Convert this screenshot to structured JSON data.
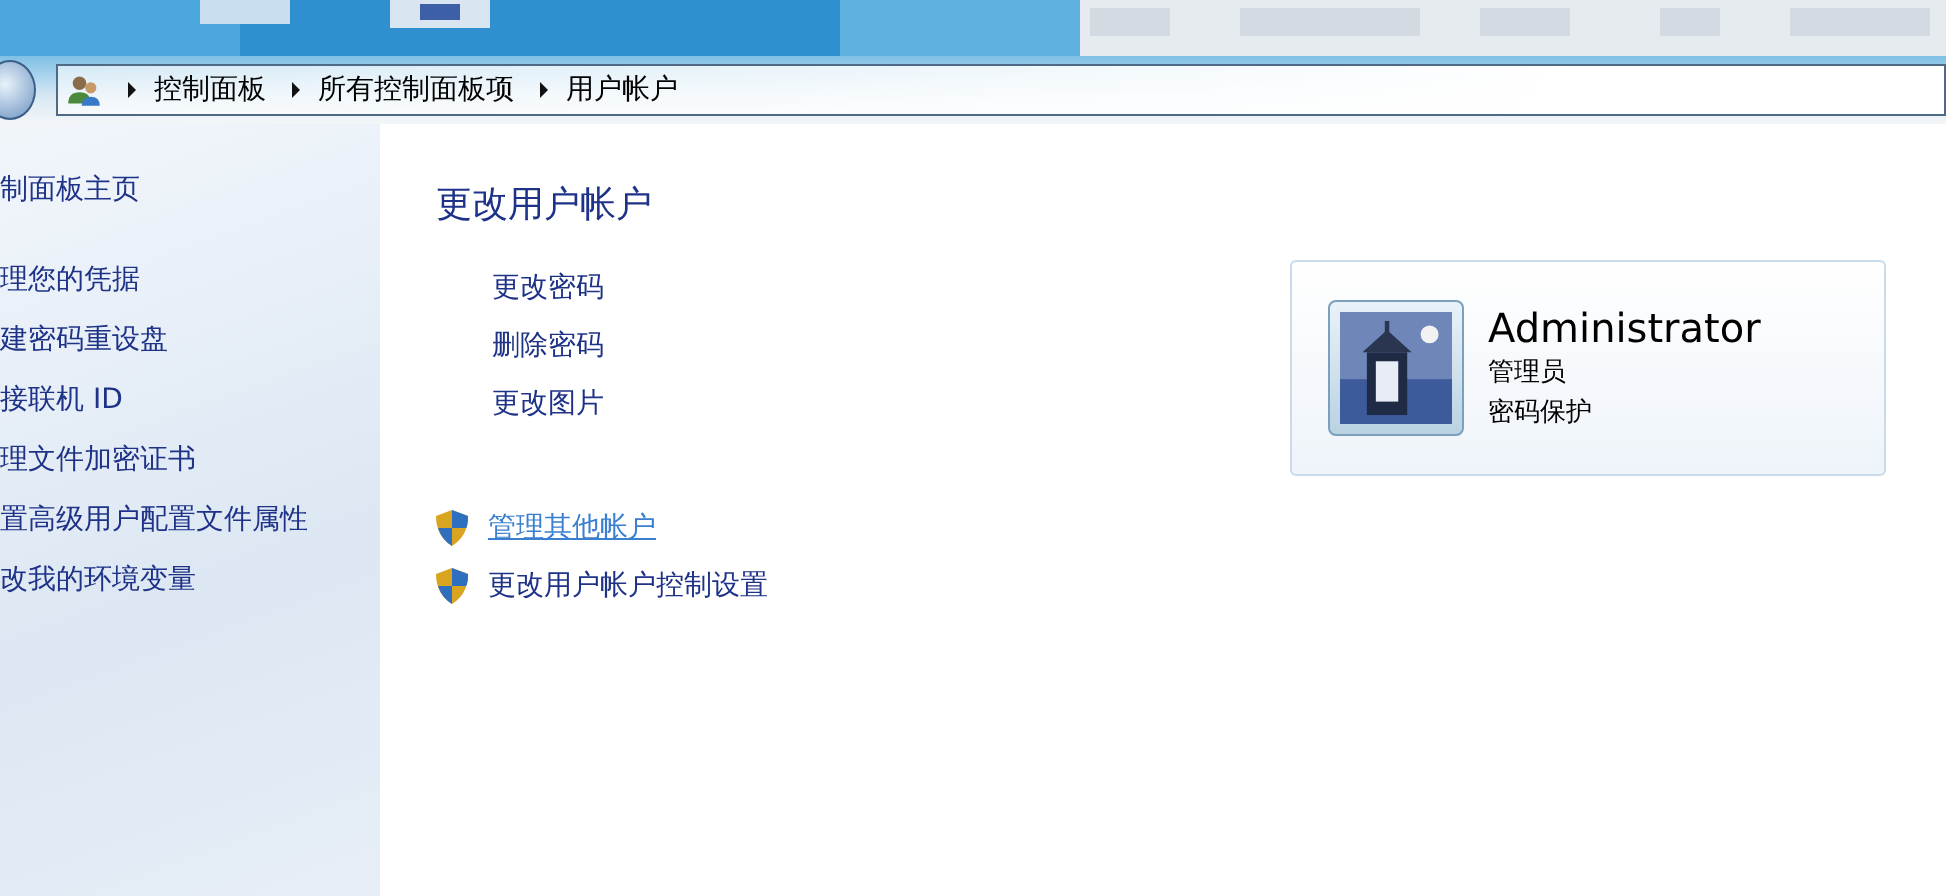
{
  "address_bar": {
    "crumbs": [
      "控制面板",
      "所有控制面板项",
      "用户帐户"
    ]
  },
  "sidebar": {
    "items": [
      {
        "label": "制面板主页",
        "kind": "home"
      },
      {
        "label": "理您的凭据",
        "kind": "task"
      },
      {
        "label": "建密码重设盘",
        "kind": "task"
      },
      {
        "label": "接联机 ID",
        "kind": "task"
      },
      {
        "label": "理文件加密证书",
        "kind": "task"
      },
      {
        "label": "置高级用户配置文件属性",
        "kind": "task"
      },
      {
        "label": "改我的环境变量",
        "kind": "task"
      }
    ]
  },
  "main": {
    "title": "更改用户帐户",
    "links": [
      {
        "label": "更改密码"
      },
      {
        "label": "删除密码"
      },
      {
        "label": "更改图片"
      }
    ],
    "admin_links": [
      {
        "label": "管理其他帐户",
        "hovered": true
      },
      {
        "label": "更改用户帐户控制设置",
        "hovered": false
      }
    ]
  },
  "account": {
    "name": "Administrator",
    "role": "管理员",
    "status": "密码保护"
  }
}
